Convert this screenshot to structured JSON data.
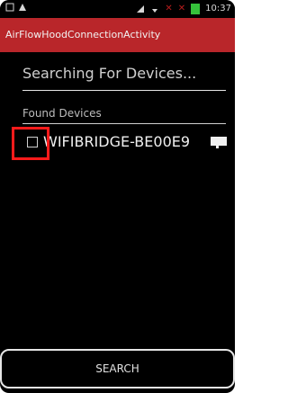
{
  "status_bar": {
    "time": "10:37",
    "icons": [
      "notification-icon",
      "alert-icon",
      "signal-icon",
      "wifi-icon",
      "mute-icon",
      "battery-icon"
    ]
  },
  "app_bar": {
    "title": "AirFlowHoodConnectionActivity",
    "color": "#b9262a"
  },
  "search": {
    "status_text": "Searching For Devices..."
  },
  "found_devices": {
    "header": "Found Devices",
    "items": [
      {
        "label": "WIFIBRIDGE-BE00E9",
        "checked": false,
        "icon": "bridge-device-icon"
      }
    ]
  },
  "actions": {
    "search_label": "SEARCH"
  }
}
